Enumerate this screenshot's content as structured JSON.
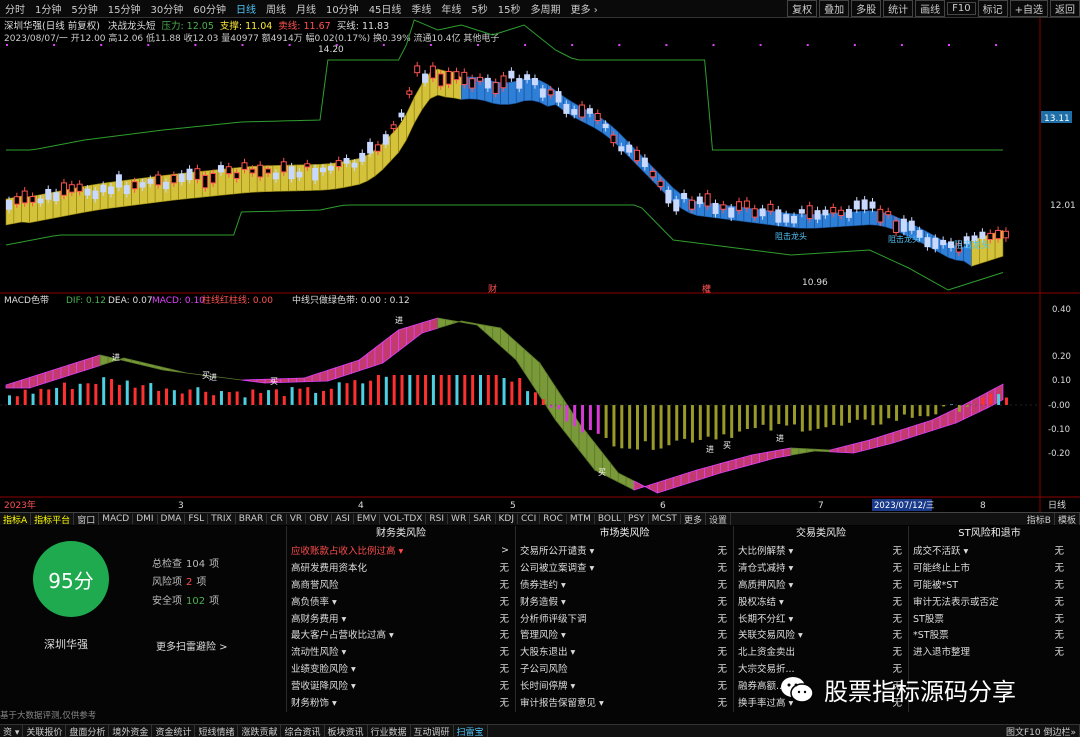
{
  "topbar": {
    "tabs": [
      "分时",
      "1分钟",
      "5分钟",
      "15分钟",
      "30分钟",
      "60分钟",
      "日线",
      "周线",
      "月线",
      "10分钟",
      "45日线",
      "季线",
      "年线",
      "5秒",
      "15秒",
      "多周期",
      "更多 ›"
    ],
    "selected": "日线",
    "right_buttons": [
      "复权",
      "叠加",
      "多股",
      "统计",
      "画线",
      "F10",
      "标记",
      "+自选",
      "返回"
    ]
  },
  "header": {
    "stock": "深圳华强(日线 前复权)",
    "indicator": "决战龙头短",
    "pressure_label": "压力: 12.05",
    "support_label": "支撑: 11.04",
    "sell_label": "卖线: 11.67",
    "buy_label": "买线: 11.83",
    "ohlc": "2023/08/07/一 开12.00 高12.06 低11.88 收12.03 量40977 额4914万 幅0.02(0.17%) 换0.39% 流通10.4亿 其他电子"
  },
  "price_chart": {
    "high_label": "14.20",
    "low_label": "10.96",
    "right_ticks": [
      "13.11",
      "12.01"
    ],
    "annotations": [
      "阻击龙头",
      "阻击龙头",
      "阻击龙头"
    ],
    "markers": [
      "财",
      "權"
    ]
  },
  "macd": {
    "title": "MACD色带",
    "dif": "DIF: 0.12",
    "dea": "DEA: 0.07",
    "macd": "MACD: 0.10",
    "red": "柱线红柱线: 0.00",
    "green": "中线只做绿色带: 0.00 : 0.12",
    "ticks": [
      "0.40",
      "0.20",
      "0.10",
      "-0.00",
      "-0.10",
      "-0.20"
    ],
    "signals": [
      "进",
      "买",
      "进",
      "买",
      "进",
      "买",
      "进",
      "买",
      "进"
    ]
  },
  "xaxis": {
    "labels": [
      "2023年",
      "3",
      "4",
      "5",
      "6",
      "7",
      "2023/07/12/三",
      "8"
    ],
    "right": "日线"
  },
  "indicator_tabs": [
    "指标A",
    "指标平台",
    "窗口",
    "MACD",
    "DMI",
    "DMA",
    "FSL",
    "TRIX",
    "BRAR",
    "CR",
    "VR",
    "OBV",
    "ASI",
    "EMV",
    "VOL-TDX",
    "RSI",
    "WR",
    "SAR",
    "KDJ",
    "CCI",
    "ROC",
    "MTM",
    "BOLL",
    "PSY",
    "MCST",
    "更多",
    "设置"
  ],
  "indicator_right": [
    "指标B",
    "模板"
  ],
  "risk": {
    "score": "95分",
    "stock": "深圳华强",
    "total_label": "总检查",
    "total": "104",
    "total_unit": "项",
    "risk_label": "风险项",
    "risk": "2",
    "risk_unit": "项",
    "safe_label": "安全项",
    "safe": "102",
    "safe_unit": "项",
    "more": "更多扫雷避险 >",
    "tip": "基于大数据评测,仅供参考",
    "risk_color": "#ff4d4d",
    "safe_color": "#4caf50"
  },
  "cols": [
    {
      "title": "财务类风险",
      "rows": [
        [
          "应收账款占收入比例过高 ▾",
          ">"
        ],
        [
          "高研发费用资本化",
          "无"
        ],
        [
          "高商誉风险",
          "无"
        ],
        [
          "高负债率 ▾",
          "无"
        ],
        [
          "高财务费用 ▾",
          "无"
        ],
        [
          "最大客户占营收比过高 ▾",
          "无"
        ],
        [
          "流动性风险 ▾",
          "无"
        ],
        [
          "业绩变脸风险 ▾",
          "无"
        ],
        [
          "营收诞降风险 ▾",
          "无"
        ],
        [
          "财务粉饰 ▾",
          "无"
        ]
      ]
    },
    {
      "title": "市场类风险",
      "rows": [
        [
          "交易所公开谴责 ▾",
          "无"
        ],
        [
          "公司被立案调查 ▾",
          "无"
        ],
        [
          "债券违约 ▾",
          "无"
        ],
        [
          "财务造假 ▾",
          "无"
        ],
        [
          "分析师评级下调",
          "无"
        ],
        [
          "管理风险 ▾",
          "无"
        ],
        [
          "大股东退出 ▾",
          "无"
        ],
        [
          "子公司风险",
          "无"
        ],
        [
          "长时间停牌 ▾",
          "无"
        ],
        [
          "审计报告保留意见 ▾",
          "无"
        ]
      ]
    },
    {
      "title": "交易类风险",
      "rows": [
        [
          "大比例解禁 ▾",
          "无"
        ],
        [
          "清仓式减持 ▾",
          "无"
        ],
        [
          "高质押风险 ▾",
          "无"
        ],
        [
          "股权冻结 ▾",
          "无"
        ],
        [
          "长期不分红 ▾",
          "无"
        ],
        [
          "关联交易风险 ▾",
          "无"
        ],
        [
          "北上资金卖出",
          "无"
        ],
        [
          "大宗交易折...",
          "无"
        ],
        [
          "融券高额...",
          "无"
        ],
        [
          "换手率过高 ▾",
          "无"
        ]
      ]
    },
    {
      "title": "ST风险和退市",
      "rows": [
        [
          "成交不活跃 ▾",
          "无"
        ],
        [
          "可能终止上市",
          "无"
        ],
        [
          "可能被*ST",
          "无"
        ],
        [
          "审计无法表示或否定",
          "无"
        ],
        [
          "ST股票",
          "无"
        ],
        [
          "*ST股票",
          "无"
        ],
        [
          "进入退市整理",
          "无"
        ]
      ]
    }
  ],
  "watermark": "股票指标源码分享",
  "bottombar": {
    "items": [
      "资 ▾",
      "关联报价",
      "盘面分析",
      "境外资金",
      "资金统计",
      "短线情绪",
      "涨跌贡献",
      "综合资讯",
      "板块资讯",
      "行业数据",
      "互动调研",
      "扫雷宝"
    ],
    "right": "图文F10 倒边栏»"
  }
}
